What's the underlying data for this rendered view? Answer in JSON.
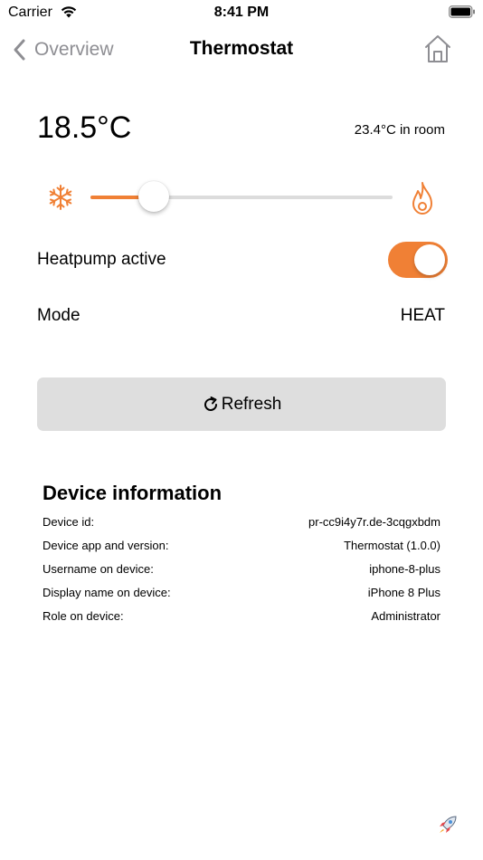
{
  "status_bar": {
    "carrier": "Carrier",
    "time": "8:41 PM"
  },
  "nav": {
    "back_label": "Overview",
    "title": "Thermostat"
  },
  "thermostat": {
    "setpoint": "18.5°C",
    "room_temp": "23.4°C in room",
    "slider_fraction": 0.21,
    "heatpump_label": "Heatpump active",
    "heatpump_active": true,
    "mode_label": "Mode",
    "mode_value": "HEAT"
  },
  "refresh": {
    "label": "Refresh"
  },
  "device_info": {
    "title": "Device information",
    "rows": [
      {
        "label": "Device id:",
        "value": "pr-cc9i4y7r.de-3cqgxbdm"
      },
      {
        "label": "Device app and version:",
        "value": "Thermostat (1.0.0)"
      },
      {
        "label": "Username on device:",
        "value": "iphone-8-plus"
      },
      {
        "label": "Display name on device:",
        "value": "iPhone 8 Plus"
      },
      {
        "label": "Role on device:",
        "value": "Administrator"
      }
    ]
  },
  "colors": {
    "accent": "#f08035",
    "button_bg": "#dedede",
    "secondary_text": "#8e8e93"
  },
  "icons": {
    "wifi": "wifi-icon",
    "battery": "battery-icon",
    "back": "chevron-left-icon",
    "home": "home-icon",
    "snow": "snowflake-icon",
    "flame": "flame-icon",
    "refresh": "refresh-icon",
    "rocket": "rocket-icon"
  }
}
